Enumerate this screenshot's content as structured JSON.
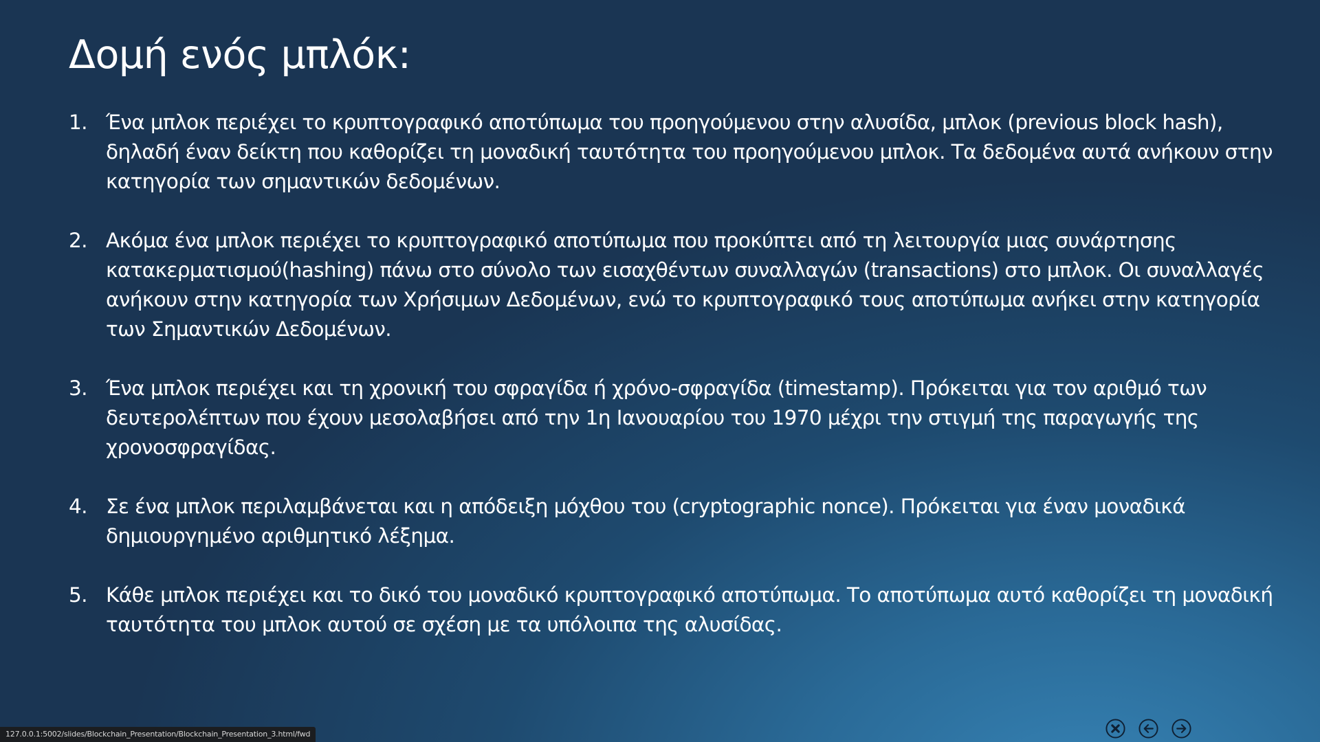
{
  "slide": {
    "title": "Δομή ενός μπλόκ:",
    "points": [
      {
        "number": "1.",
        "text": "Ένα μπλοκ περιέχει το κρυπτογραφικό αποτύπωμα του προηγούμενου στην αλυσίδα, μπλοκ (previous block hash), δηλαδή έναν δείκτη που καθορίζει τη μοναδική ταυτότητα του προηγούμενου μπλοκ. Τα δεδομένα αυτά ανήκουν στην κατηγορία των σημαντικών δεδομένων."
      },
      {
        "number": "2.",
        "text": "Ακόμα ένα μπλοκ περιέχει το κρυπτογραφικό αποτύπωμα που προκύπτει από τη λειτουργία μιας συνάρτησης κατακερματισμού(hashing) πάνω στο σύνολο των εισαχθέντων συναλλαγών (transactions) στο μπλοκ. Οι συναλλαγές ανήκουν στην κατηγορία των Χρήσιμων Δεδομένων, ενώ το κρυπτογραφικό τους αποτύπωμα ανήκει στην κατηγορία των Σημαντικών Δεδομένων."
      },
      {
        "number": "3.",
        "text": "Ένα μπλοκ περιέχει και τη χρονική του σφραγίδα ή χρόνο-σφραγίδα (timestamp). Πρόκειται για τον αριθμό των δευτερολέπτων που έχουν μεσολαβήσει από την 1η Ιανουαρίου του 1970 μέχρι την στιγμή της παραγωγής της χρονοσφραγίδας."
      },
      {
        "number": "4.",
        "text": "Σε ένα μπλοκ περιλαμβάνεται και η απόδειξη μόχθου του (cryptographic nonce). Πρόκειται για έναν μοναδικά δημιουργημένο αριθμητικό λέξημα."
      },
      {
        "number": "5.",
        "text": "Κάθε μπλοκ περιέχει και το δικό του μοναδικό κρυπτογραφικό αποτύπωμα. Το αποτύπωμα αυτό καθορίζει τη μοναδική ταυτότητα του μπλοκ αυτού σε σχέση με τα υπόλοιπα της αλυσίδας."
      }
    ]
  },
  "status_bar": {
    "url": "127.0.0.1:5002/slides/Blockchain_Presentation/Blockchain_Presentation_3.html/fwd"
  },
  "navigation": {
    "icons": [
      "close-icon",
      "arrow-left-icon",
      "arrow-right-icon"
    ],
    "icon_color": "#0f2033"
  }
}
